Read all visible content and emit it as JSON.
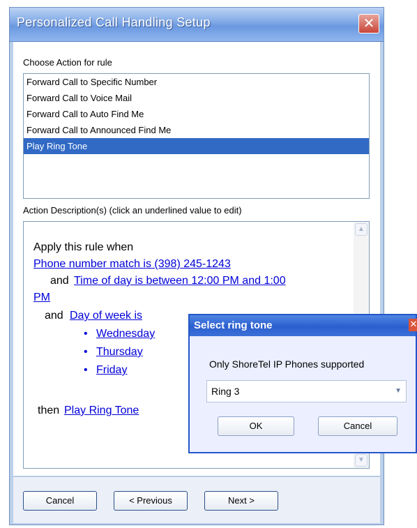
{
  "window": {
    "title": "Personalized Call Handling Setup",
    "close_glyph": "✕"
  },
  "action_section": {
    "label": "Choose Action for rule",
    "items": [
      {
        "label": "Forward Call to Specific Number",
        "selected": false
      },
      {
        "label": "Forward Call to Voice Mail",
        "selected": false
      },
      {
        "label": "Forward Call to Auto Find Me",
        "selected": false
      },
      {
        "label": "Forward Call to Announced Find Me",
        "selected": false
      },
      {
        "label": "Play Ring Tone",
        "selected": true
      }
    ]
  },
  "description": {
    "label": "Action Description(s) (click an underlined value to edit)",
    "apply_text": "Apply this rule when",
    "phone_link": "Phone number match is (398) 245-1243",
    "and1": "and",
    "time_link_a": "Time of day is between 12:00 PM and 1:00",
    "time_link_b": "PM",
    "and2": "and",
    "dow_link": "Day of week is",
    "days": [
      "Wednesday",
      "Thursday",
      "Friday"
    ],
    "then_text": "then",
    "action_link": "Play Ring Tone"
  },
  "footer": {
    "cancel": "Cancel",
    "previous": "< Previous",
    "next": "Next >"
  },
  "popup": {
    "title": "Select ring tone",
    "close_glyph": "✕",
    "info": "Only ShoreTel IP Phones supported",
    "selected_value": "Ring 3",
    "ok": "OK",
    "cancel": "Cancel"
  },
  "colors": {
    "selection": "#316ac5",
    "link": "#0000d8",
    "title_bar": "#6a98e0"
  }
}
